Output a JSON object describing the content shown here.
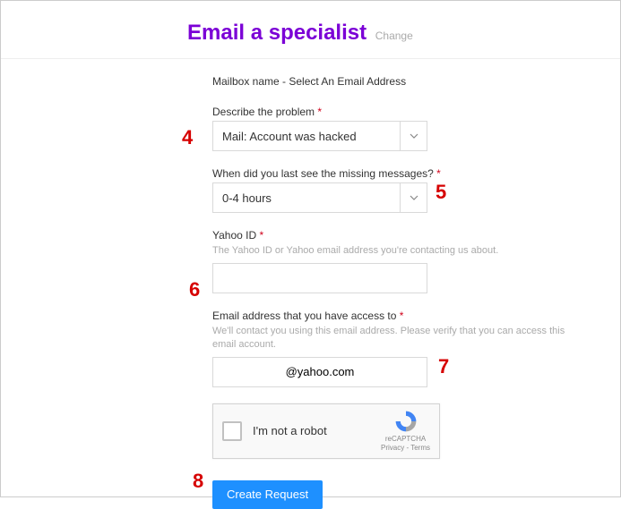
{
  "header": {
    "title": "Email a specialist",
    "change": "Change"
  },
  "mailbox_line": "Mailbox name - Select An Email Address",
  "problem": {
    "label": "Describe the problem",
    "value": "Mail: Account was hacked"
  },
  "lastseen": {
    "label": "When did you last see the missing messages?",
    "value": "0-4 hours"
  },
  "yahoo_id": {
    "label": "Yahoo ID",
    "hint": "The Yahoo ID or Yahoo email address you're contacting us about.",
    "value": ""
  },
  "access_email": {
    "label": "Email address that you have access to",
    "hint": "We'll contact you using this email address. Please verify that you can access this email account.",
    "value": "@yahoo.com"
  },
  "captcha": {
    "label": "I'm not a robot",
    "brand": "reCAPTCHA",
    "links": "Privacy - Terms"
  },
  "submit": "Create Request",
  "annotations": {
    "a4": "4",
    "a5": "5",
    "a6": "6",
    "a7": "7",
    "a8": "8"
  }
}
